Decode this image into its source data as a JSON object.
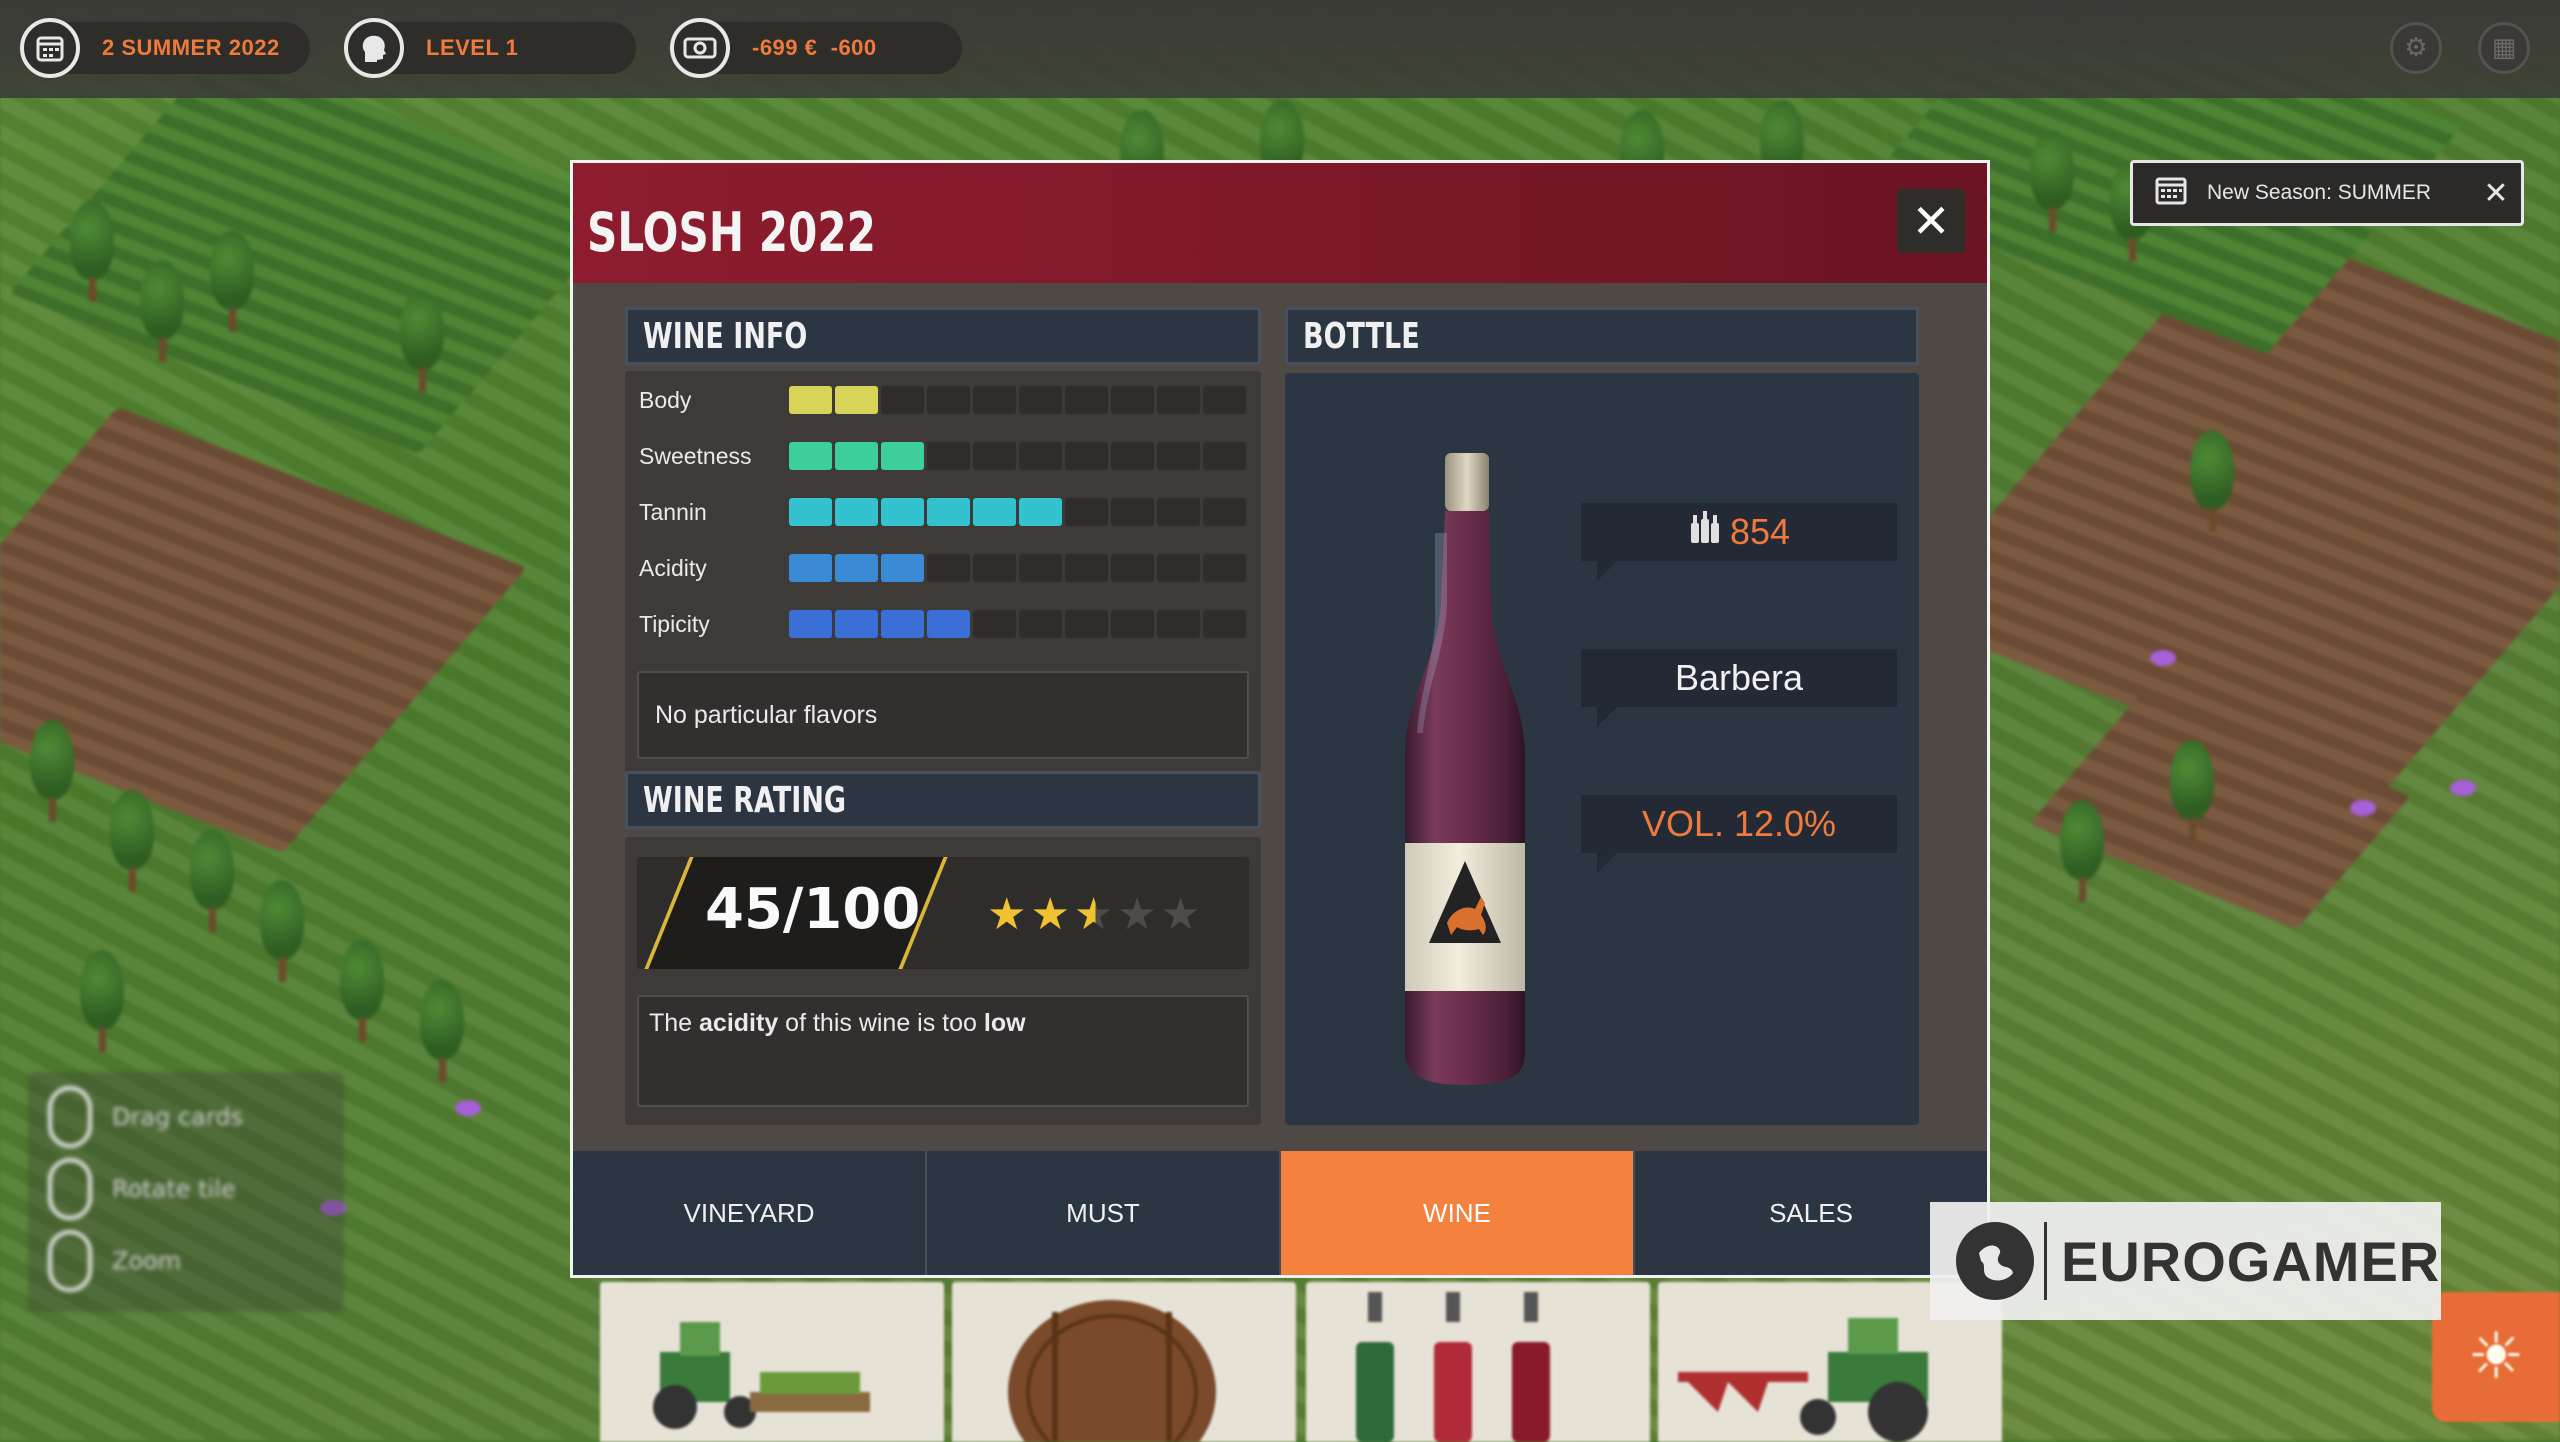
{
  "hud": {
    "date": "2 SUMMER 2022",
    "level": "LEVEL 1",
    "money": "-699 €",
    "money_delta": "-600",
    "date_icon": "calendar-icon",
    "level_icon": "head-icon",
    "money_icon": "money-icon",
    "settings_icon": "gear-icon",
    "menu_icon": "grid-icon"
  },
  "notification": {
    "text": "New Season: SUMMER",
    "icon": "calendar-icon",
    "close": "✕"
  },
  "dialog": {
    "title": "SLOSH 2022",
    "close": "✕",
    "wine_info": {
      "heading": "WINE INFO",
      "total_segments": 10,
      "stats": [
        {
          "label": "Body",
          "value": 2,
          "color": "#d8d45a"
        },
        {
          "label": "Sweetness",
          "value": 3,
          "color": "#3ccf9c"
        },
        {
          "label": "Tannin",
          "value": 6,
          "color": "#33c3d0"
        },
        {
          "label": "Acidity",
          "value": 3,
          "color": "#3a8ad6"
        },
        {
          "label": "Tipicity",
          "value": 4,
          "color": "#3a6fd6"
        }
      ],
      "flavors": "No particular flavors"
    },
    "wine_rating": {
      "heading": "WINE RATING",
      "score": "45/100",
      "stars": 2.5,
      "max_stars": 5,
      "comment_pre": "The ",
      "comment_b1": "acidity",
      "comment_mid": " of this wine is too ",
      "comment_b2": "low"
    },
    "bottle": {
      "heading": "BOTTLE",
      "count": "854",
      "variety": "Barbera",
      "vol": "VOL. 12.0%",
      "count_color": "#f07a3c",
      "vol_color": "#f07a3c"
    },
    "tabs": [
      {
        "label": "VINEYARD",
        "active": false
      },
      {
        "label": "MUST",
        "active": false
      },
      {
        "label": "WINE",
        "active": true
      },
      {
        "label": "SALES",
        "active": false
      }
    ]
  },
  "controls": {
    "drag": "Drag cards",
    "rotate": "Rotate tile",
    "zoom": "Zoom"
  },
  "watermark": "EUROGAMER"
}
